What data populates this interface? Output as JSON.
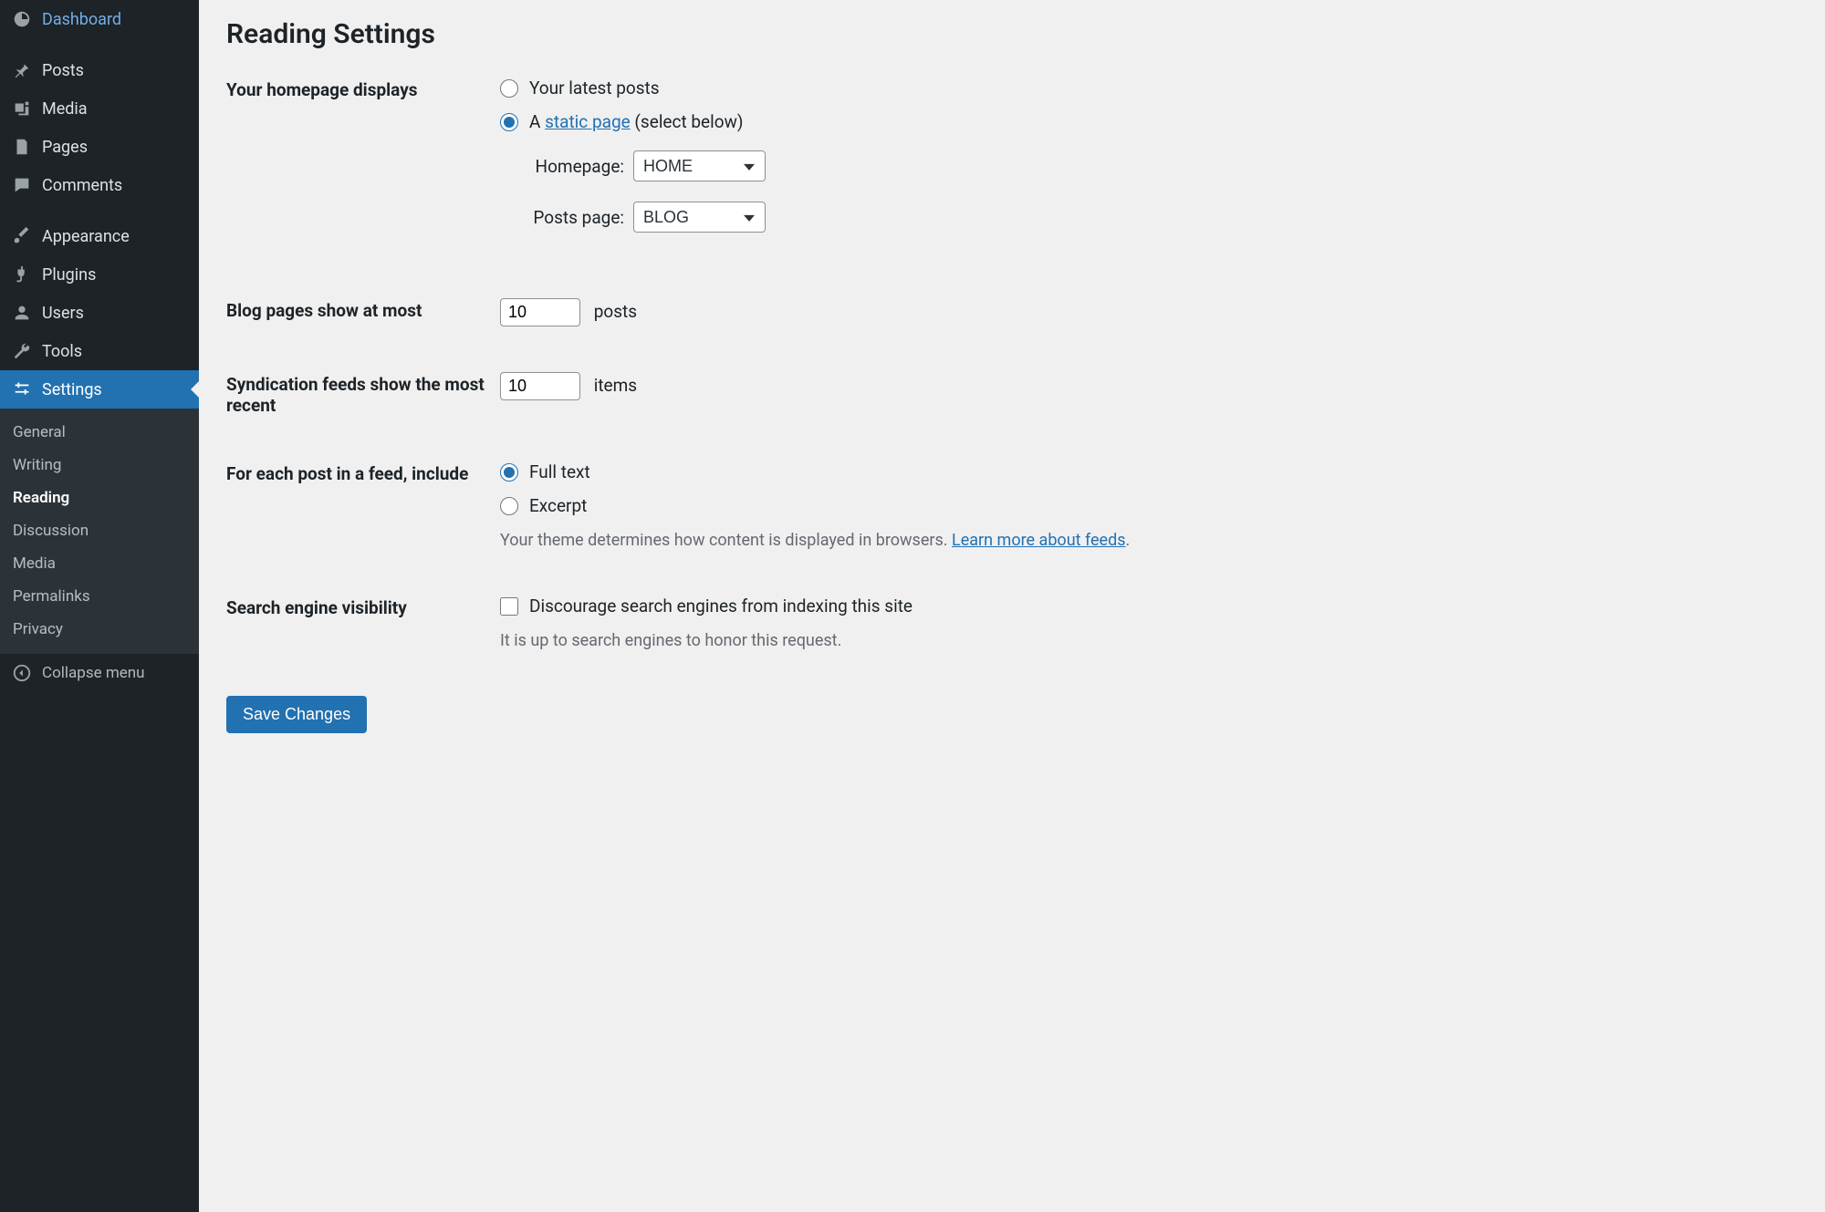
{
  "sidebar": {
    "items": [
      {
        "label": "Dashboard"
      },
      {
        "label": "Posts"
      },
      {
        "label": "Media"
      },
      {
        "label": "Pages"
      },
      {
        "label": "Comments"
      },
      {
        "label": "Appearance"
      },
      {
        "label": "Plugins"
      },
      {
        "label": "Users"
      },
      {
        "label": "Tools"
      },
      {
        "label": "Settings"
      }
    ],
    "submenu": [
      {
        "label": "General"
      },
      {
        "label": "Writing"
      },
      {
        "label": "Reading"
      },
      {
        "label": "Discussion"
      },
      {
        "label": "Media"
      },
      {
        "label": "Permalinks"
      },
      {
        "label": "Privacy"
      }
    ],
    "collapse_label": "Collapse menu"
  },
  "page": {
    "title": "Reading Settings",
    "homepage_displays": {
      "label": "Your homepage displays",
      "opt_latest": "Your latest posts",
      "opt_static_prefix": "A ",
      "opt_static_link": "static page",
      "opt_static_suffix": " (select below)",
      "homepage_label": "Homepage:",
      "homepage_value": "HOME",
      "postspage_label": "Posts page:",
      "postspage_value": "BLOG"
    },
    "blog_pages": {
      "label": "Blog pages show at most",
      "value": "10",
      "unit": "posts"
    },
    "syndication": {
      "label": "Syndication feeds show the most recent",
      "value": "10",
      "unit": "items"
    },
    "feed_include": {
      "label": "For each post in a feed, include",
      "opt_full": "Full text",
      "opt_excerpt": "Excerpt",
      "help_prefix": "Your theme determines how content is displayed in browsers. ",
      "help_link": "Learn more about feeds",
      "help_suffix": "."
    },
    "search_visibility": {
      "label": "Search engine visibility",
      "checkbox_label": "Discourage search engines from indexing this site",
      "help": "It is up to search engines to honor this request."
    },
    "save_label": "Save Changes"
  }
}
